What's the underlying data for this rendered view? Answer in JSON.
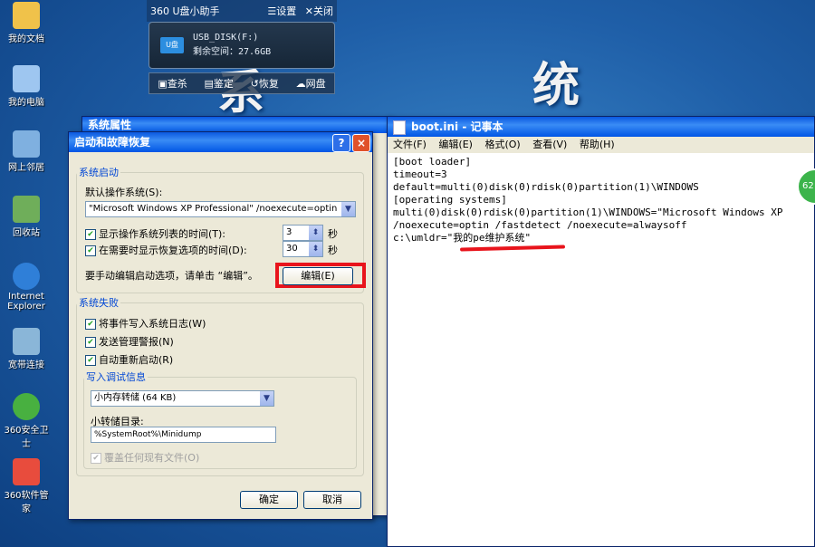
{
  "desktop": {
    "icons": [
      {
        "label": "我的文档",
        "icon": "folder-icon",
        "color": "#f0c24a"
      },
      {
        "label": "我的电脑",
        "icon": "computer-icon",
        "color": "#9ec6f0"
      },
      {
        "label": "网上邻居",
        "icon": "network-icon",
        "color": "#7fb0e0"
      },
      {
        "label": "回收站",
        "icon": "recycle-bin-icon",
        "color": "#6fae5a"
      },
      {
        "label": "Internet Explorer",
        "icon": "ie-icon",
        "color": "#2f7fd8"
      },
      {
        "label": "宽带连接",
        "icon": "broadband-icon",
        "color": "#8ab6d8"
      },
      {
        "label": "360安全卫士",
        "icon": "shield-icon",
        "color": "#48b040"
      },
      {
        "label": "360软件管家",
        "icon": "app-store-icon",
        "color": "#e84c3d"
      }
    ],
    "bg_chars": [
      "系",
      "统"
    ]
  },
  "usb_widget": {
    "title": "360 U盘小助手",
    "settings": "设置",
    "close": "关闭",
    "drive_badge": "U盘",
    "drive_name": "USB_DISK(F:)",
    "free_space": "剩余空间：27.6GB",
    "tools": [
      "查杀",
      "鉴定",
      "恢复",
      "网盘"
    ]
  },
  "bg_window": {
    "title": "系统属性"
  },
  "dialog": {
    "title": "启动和故障恢复",
    "help": "?",
    "close": "×",
    "startup": {
      "legend": "系统启动",
      "default_os_label": "默认操作系统(S):",
      "default_os_value": "\"Microsoft Windows XP Professional\" /noexecute=optin",
      "show_list_label": "显示操作系统列表的时间(T):",
      "show_list_value": "3",
      "show_recovery_label": "在需要时显示恢复选项的时间(D):",
      "show_recovery_value": "30",
      "unit": "秒",
      "edit_hint": "要手动编辑启动选项，请单击 “编辑”。",
      "edit_button": "编辑(E)"
    },
    "failure": {
      "legend": "系统失败",
      "write_event": "将事件写入系统日志(W)",
      "send_alert": "发送管理警报(N)",
      "auto_restart": "自动重新启动(R)",
      "debug_legend": "写入调试信息",
      "debug_value": "小内存转储 (64 KB)",
      "dump_dir_label": "小转储目录:",
      "dump_dir_value": "%SystemRoot%\\Minidump",
      "overwrite": "覆盖任何现有文件(O)"
    },
    "ok": "确定",
    "cancel": "取消"
  },
  "notepad": {
    "title": "boot.ini - 记事本",
    "menu": [
      "文件(F)",
      "编辑(E)",
      "格式(O)",
      "查看(V)",
      "帮助(H)"
    ],
    "lines": [
      "[boot loader]",
      "timeout=3",
      "default=multi(0)disk(0)rdisk(0)partition(1)\\WINDOWS",
      "[operating systems]",
      "multi(0)disk(0)rdisk(0)partition(1)\\WINDOWS=\"Microsoft Windows XP",
      "/noexecute=optin /fastdetect /noexecute=alwaysoff",
      "c:\\umldr=\"我的pe维护系统\""
    ]
  },
  "badge": "62",
  "colors": {
    "highlight_red": "#e8141c",
    "title_blue": "#0a58e0"
  }
}
